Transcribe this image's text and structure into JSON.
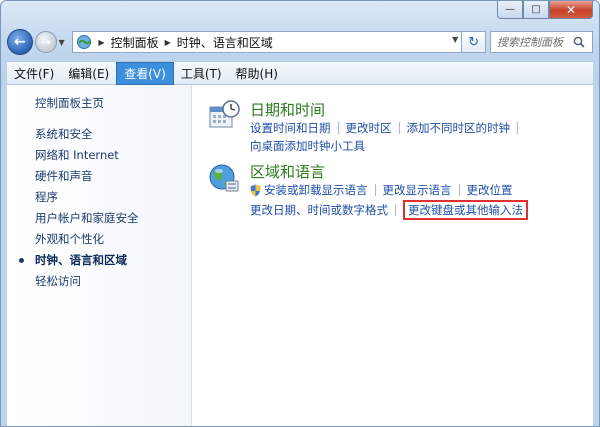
{
  "window": {
    "caption": {
      "minimize": "—",
      "maximize": "□",
      "close": "✕"
    },
    "colors": {
      "accent": "#3b8fdc",
      "section_title": "#2d7a1f",
      "link": "#1f4fa6",
      "highlight_border": "#e0302f"
    }
  },
  "nav": {
    "back_glyph": "←",
    "forward_glyph": "→",
    "breadcrumbs": [
      "控制面板",
      "时钟、语言和区域"
    ],
    "refresh_glyph": "↻",
    "search_placeholder": "搜索控制面板"
  },
  "menu": [
    {
      "label": "文件(F)"
    },
    {
      "label": "编辑(E)"
    },
    {
      "label": "查看(V)"
    },
    {
      "label": "工具(T)"
    },
    {
      "label": "帮助(H)"
    }
  ],
  "sidebar": {
    "home": "控制面板主页",
    "items": [
      {
        "label": "系统和安全"
      },
      {
        "label": "网络和 Internet"
      },
      {
        "label": "硬件和声音"
      },
      {
        "label": "程序"
      },
      {
        "label": "用户帐户和家庭安全"
      },
      {
        "label": "外观和个性化"
      },
      {
        "label": "时钟、语言和区域"
      },
      {
        "label": "轻松访问"
      }
    ]
  },
  "sections": {
    "datetime": {
      "title": "日期和时间",
      "links": [
        "设置时间和日期",
        "更改时区",
        "添加不同时区的时钟",
        "向桌面添加时钟小工具"
      ]
    },
    "region": {
      "title": "区域和语言",
      "links": [
        "安装或卸载显示语言",
        "更改显示语言",
        "更改位置",
        "更改日期、时间或数字格式",
        "更改键盘或其他输入法"
      ]
    }
  }
}
